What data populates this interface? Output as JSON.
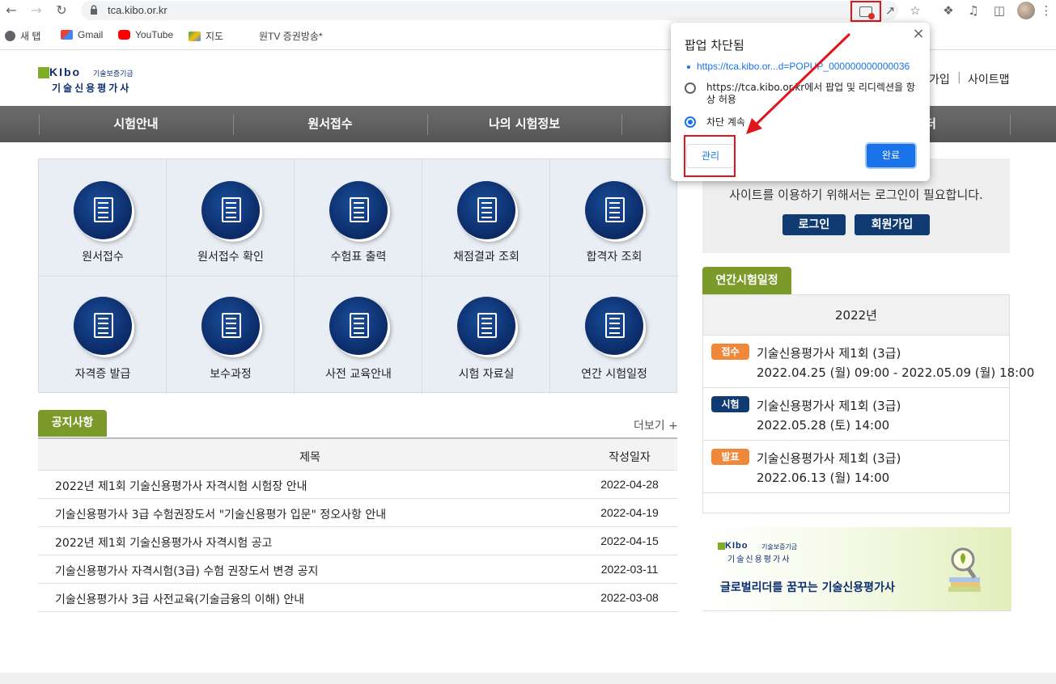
{
  "browser": {
    "url": "tca.kibo.or.kr",
    "bookmarks": [
      "새 탭",
      "Gmail",
      "YouTube",
      "지도",
      "원TV 증권방송*"
    ]
  },
  "popup": {
    "title": "팝업 차단됨",
    "blocked_link": "https://tca.kibo.or...d=POPUP_000000000000036",
    "option_allow": "https://tca.kibo.or.kr에서 팝업 및 리디렉션을 항상 허용",
    "option_block": "차단 계속",
    "selected": "option_block",
    "manage_label": "관리",
    "done_label": "완료"
  },
  "header": {
    "logo_en": "KIbo",
    "logo_ko_small": "기술보증기금",
    "logo_ko": "기술신용평가사",
    "util_signup": "가입",
    "util_separator": "|",
    "util_sitemap": "사이트맵"
  },
  "gnb": [
    "시험안내",
    "원서접수",
    "나의 시험정보",
    "",
    "터"
  ],
  "quick_menu": [
    "원서접수",
    "원서접수 확인",
    "수험표 출력",
    "채점결과 조회",
    "합격자 조회",
    "자격증 발급",
    "보수과정",
    "사전 교육안내",
    "시험 자료실",
    "연간 시험일정"
  ],
  "notice": {
    "tab": "공지사항",
    "more": "더보기 +",
    "col_title": "제목",
    "col_date": "작성일자",
    "rows": [
      {
        "title": "2022년 제1회 기술신용평가사 자격시험 시험장 안내",
        "date": "2022-04-28"
      },
      {
        "title": "기술신용평가사 3급 수험권장도서 \"기술신용평가 입문\" 정오사항 안내",
        "date": "2022-04-19"
      },
      {
        "title": "2022년 제1회 기술신용평가사 자격시험 공고",
        "date": "2022-04-15"
      },
      {
        "title": "기술신용평가사 자격시험(3급) 수험 권장도서 변경 공지",
        "date": "2022-03-11"
      },
      {
        "title": "기술신용평가사 3급 사전교육(기술금융의 이해) 안내",
        "date": "2022-03-08"
      }
    ]
  },
  "login": {
    "message": "사이트를 이용하기 위해서는 로그인이 필요합니다.",
    "login_label": "로그인",
    "signup_label": "회원가입"
  },
  "schedule": {
    "tab": "연간시험일정",
    "year": "2022년",
    "items": [
      {
        "badge": "접수",
        "badge_color": "#f0883a",
        "title": "기술신용평가사 제1회 (3급)",
        "date": "2022.04.25 (월) 09:00 - 2022.05.09 (월) 18:00"
      },
      {
        "badge": "시험",
        "badge_color": "#0f3a72",
        "title": "기술신용평가사 제1회 (3급)",
        "date": "2022.05.28 (토) 14:00"
      },
      {
        "badge": "발표",
        "badge_color": "#f0883a",
        "title": "기술신용평가사 제1회 (3급)",
        "date": "2022.06.13 (월) 14:00"
      }
    ]
  },
  "banner": {
    "logo_en": "KIbo",
    "logo_ko_small": "기술보증기금",
    "logo_ko": "기술신용평가사",
    "slogan": "글로벌리더를 꿈꾸는 기술신용평가사"
  },
  "colors": {
    "nav_dark": "#0f3a72",
    "accent_green": "#7b9a2a",
    "highlight_red": "#e0151b",
    "chrome_blue": "#1a73e8"
  }
}
